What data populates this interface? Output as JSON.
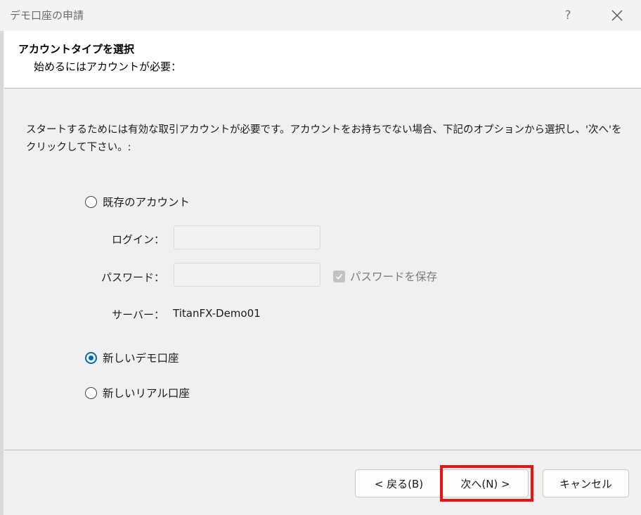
{
  "window": {
    "title": "デモ口座の申請",
    "help_label": "?",
    "close_icon": "close-icon"
  },
  "header": {
    "title": "アカウントタイプを選択",
    "subtitle": "始めるにはアカウントが必要："
  },
  "description": "スタートするためには有効な取引アカウントが必要です。アカウントをお持ちでない場合、下記のオプションから選択し、'次へ'をクリックして下さい。:",
  "options": {
    "existing_label": "既存のアカウント",
    "new_demo_label": "新しいデモ口座",
    "new_real_label": "新しいリアル口座",
    "selected": "new_demo"
  },
  "fields": {
    "login_label": "ログイン：",
    "login_value": "",
    "password_label": "パスワード：",
    "password_value": "",
    "save_password_label": "パスワードを保存",
    "save_password_checked": true,
    "server_label": "サーバー：",
    "server_value": "TitanFX-Demo01"
  },
  "buttons": {
    "back": "< 戻る(B)",
    "next": "次へ(N) >",
    "cancel": "キャンセル"
  },
  "colors": {
    "accent": "#0067c0",
    "highlight": "#ee1111"
  }
}
